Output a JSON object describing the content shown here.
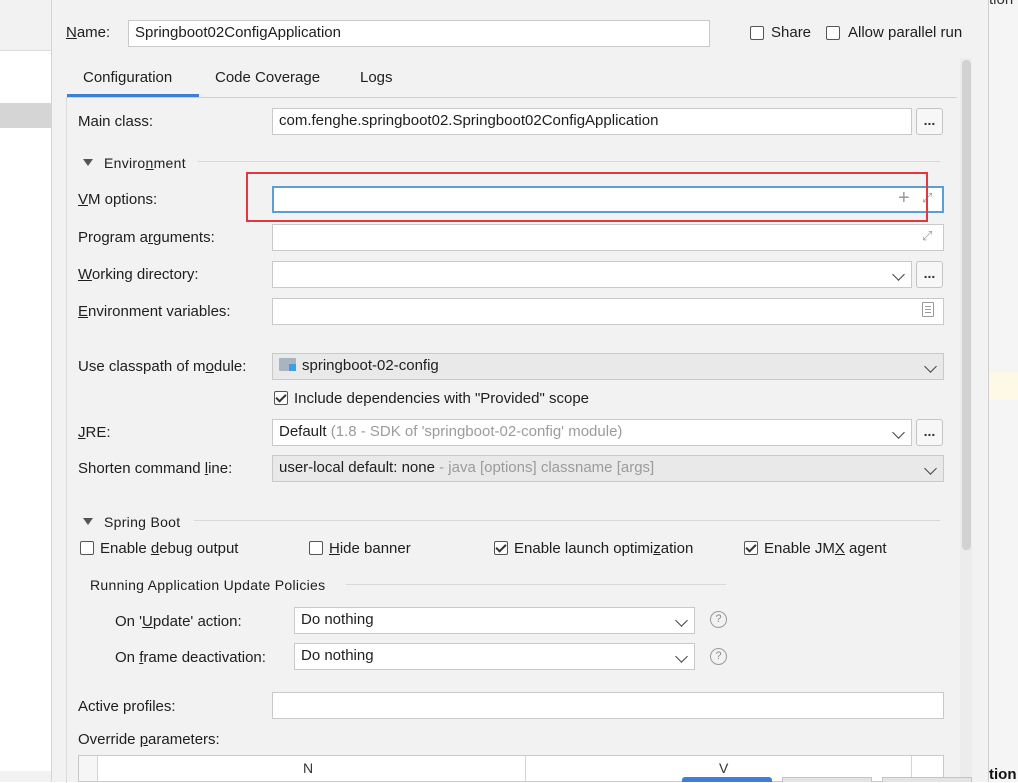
{
  "header": {
    "name_label": "Name:",
    "name_value": "Springboot02ConfigApplication",
    "share_label": "Share",
    "share_checked": false,
    "parallel_label": "Allow parallel run",
    "parallel_checked": false
  },
  "tabs": [
    {
      "label": "Configuration",
      "active": true
    },
    {
      "label": "Code Coverage",
      "active": false
    },
    {
      "label": "Logs",
      "active": false
    }
  ],
  "config": {
    "main_class_label": "Main class:",
    "main_class_value": "com.fenghe.springboot02.Springboot02ConfigApplication",
    "environment_title": "Environment",
    "vm_options_label": "VM options:",
    "vm_options_value": "",
    "program_args_label": "Program arguments:",
    "program_args_value": "",
    "working_dir_label": "Working directory:",
    "working_dir_value": "",
    "env_vars_label": "Environment variables:",
    "env_vars_value": "",
    "classpath_label": "Use classpath of module:",
    "classpath_value": "springboot-02-config",
    "include_deps_label": "Include dependencies with \"Provided\" scope",
    "include_deps_checked": true,
    "jre_label": "JRE:",
    "jre_value": "Default",
    "jre_hint": "(1.8 - SDK of 'springboot-02-config' module)",
    "shorten_label": "Shorten command line:",
    "shorten_value": "user-local default: none",
    "shorten_hint": " - java [options] classname [args]"
  },
  "spring_boot": {
    "title": "Spring Boot",
    "debug_label": "Enable debug output",
    "debug_checked": false,
    "hide_banner_label": "Hide banner",
    "hide_banner_checked": false,
    "launch_opt_label": "Enable launch optimization",
    "launch_opt_checked": true,
    "jmx_label": "Enable JMX agent",
    "jmx_checked": true,
    "policies_title": "Running Application Update Policies",
    "update_action_label": "On 'Update' action:",
    "update_action_value": "Do nothing",
    "frame_deact_label": "On frame deactivation:",
    "frame_deact_value": "Do nothing",
    "help_glyph": "?",
    "active_profiles_label": "Active profiles:",
    "active_profiles_value": "",
    "override_label": "Override parameters:",
    "table_col_name": "N",
    "table_col_value": "V"
  },
  "glyphs": {
    "dots": "...",
    "plus": "+",
    "expand": "⤢"
  },
  "edge_text": {
    "top": "tion",
    "bottom": "tion"
  },
  "colors": {
    "accent_tab": "#3d7ed8",
    "focus_border": "#5a9ed6",
    "highlight_box": "#e0383e"
  }
}
